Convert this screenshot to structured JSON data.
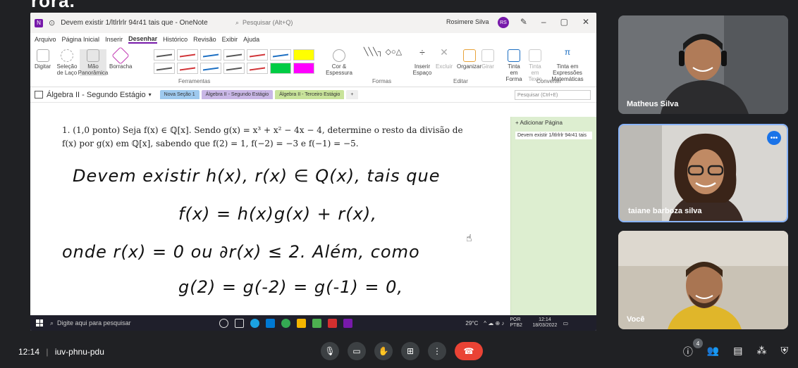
{
  "caption": "rora.",
  "onenote": {
    "window_title": "Devem existir 1/ltlrlrlr 94r41 tais que - OneNote",
    "search_placeholder": "Pesquisar (Alt+Q)",
    "user_name": "Rosimere Silva",
    "user_initials": "RS",
    "menu": [
      "Arquivo",
      "Página Inicial",
      "Inserir",
      "Desenhar",
      "Histórico",
      "Revisão",
      "Exibir",
      "Ajuda"
    ],
    "active_menu": "Desenhar",
    "ribbon": {
      "digitar": "Digitar",
      "selecao": "Seleção de Laço",
      "mao": "Mão Panorâmica",
      "borracha": "Borracha",
      "cor": "Cor & Espessura",
      "inserir_espaco": "Inserir Espaço",
      "excluir": "Excluir",
      "organizar": "Organizar",
      "girar": "Girar",
      "tinta_forma": "Tinta em Forma",
      "tinta_texto": "Tinta em Texto",
      "tinta_expr": "Tinta em Expressões Matemáticas",
      "groups": [
        "Ferramentas",
        "Formas",
        "Editar",
        "Converter"
      ]
    },
    "pen_colors": [
      "#555555",
      "#d13438",
      "#1b6ec2",
      "#555555",
      "#d13438",
      "#1b6ec2",
      "#ffff00",
      "#555555",
      "#d13438",
      "#1b6ec2",
      "#555555",
      "#d13438",
      "#00cc44",
      "#ff00ff"
    ],
    "notebook": "Álgebra II - Segundo Estágio",
    "tabs": [
      "Nova Seção 1",
      "Álgebra II - Segundo Estágio",
      "Álgebra II - Terceiro Estágio",
      "+"
    ],
    "search_notebook": "Pesquisar (Ctrl+E)",
    "add_page": "+ Adicionar Página",
    "page_item": "Devem existir 1/ltlrlrlr 94r41 tais",
    "problem": "1. (1,0 ponto) Seja f(x) ∈ ℚ[x]. Sendo g(x) = x³ + x² − 4x − 4, determine o resto da divisão de f(x) por g(x) em ℚ[x], sabendo que f(2) = 1, f(−2) = −3 e f(−1) = −5.",
    "handwriting": [
      "Devem existir   h(x), r(x) ∈ Q(x),  tais que",
      "f(x) = h(x)g(x) + r(x),",
      "onde  r(x) = 0  ou  ∂r(x) ≤ 2.  Além, como",
      "g(2) = g(-2) = g(-1) = 0,"
    ]
  },
  "taskbar": {
    "search": "Digite aqui para pesquisar",
    "temp": "29°C",
    "lang": "POR PTB2",
    "time": "12:14",
    "date": "18/03/2022"
  },
  "participants": [
    {
      "name": "Matheus Silva"
    },
    {
      "name": "taiane barboza silva"
    },
    {
      "name": "Você"
    }
  ],
  "meeting": {
    "time": "12:14",
    "code": "iuv-phnu-pdu",
    "people_count": "4"
  }
}
